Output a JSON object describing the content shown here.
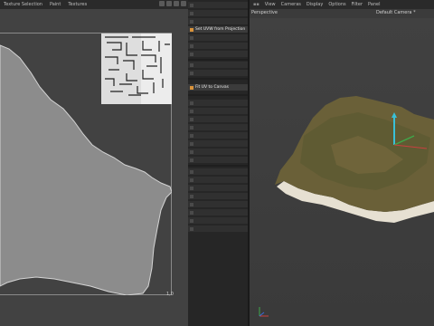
{
  "uv_editor": {
    "menu": [
      "Texture Selection",
      "Paint",
      "Textures"
    ],
    "corner_label": "1,0"
  },
  "tool_menu": {
    "active_items": [
      "Set UVW from Projection",
      "Fit UV to Canvas"
    ]
  },
  "viewport": {
    "menu": [
      "View",
      "Cameras",
      "Display",
      "Options",
      "Filter",
      "Panel"
    ],
    "view_name": "Perspective",
    "camera": "Default Camera *"
  },
  "colors": {
    "uv_fill": "#8c8c8c",
    "accent": "#d8923a",
    "terrain": "#6a6038",
    "cliff": "#e6e0d2"
  }
}
